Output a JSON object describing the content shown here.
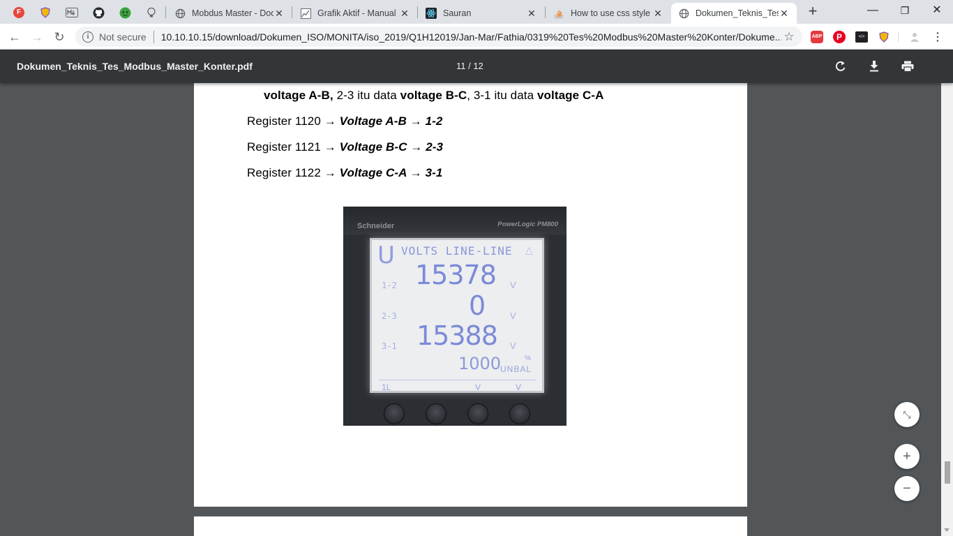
{
  "browser": {
    "pinned_tabs": [
      {
        "icon": "f-letter-icon",
        "color": "#e8453c"
      },
      {
        "icon": "shield-extension-icon",
        "color": "#f2b705"
      },
      {
        "icon": "markdown-icon",
        "color": "#5f6368"
      },
      {
        "icon": "github-icon",
        "color": "#24292e"
      },
      {
        "icon": "green-face-icon",
        "color": "#3ba13d"
      },
      {
        "icon": "bulb-icon",
        "color": "#5f6368"
      }
    ],
    "tabs": [
      {
        "title": "Mobdus Master - Doc",
        "icon": "globe-icon",
        "active": false
      },
      {
        "title": "Grafik Aktif - Manual",
        "icon": "chart-icon",
        "active": false
      },
      {
        "title": "Sauran",
        "icon": "react-icon",
        "active": false
      },
      {
        "title": "How to use css style in",
        "icon": "stackoverflow-icon",
        "active": false
      },
      {
        "title": "Dokumen_Teknis_Tes_",
        "icon": "globe-icon",
        "active": true
      }
    ],
    "new_tab_label": "+",
    "window_controls": {
      "minimize": "—",
      "restore": "❐",
      "close": "✕"
    },
    "omnibox": {
      "security_label": "Not secure",
      "url": "10.10.10.15/download/Dokumen_ISO/MONITA/iso_2019/Q1H12019/Jan-Mar/Fathia/0319%20Tes%20Modbus%20Master%20Konter/Dokume..."
    },
    "extensions": [
      {
        "name": "abp-icon",
        "text": "ABP",
        "color": "#e6393e"
      },
      {
        "name": "pinterest-icon",
        "text": "P",
        "color": "#e60023"
      },
      {
        "name": "code-extension-icon",
        "text": "</>",
        "color": "#202124"
      },
      {
        "name": "shield-extension-icon",
        "text": "",
        "color": "#f2b705"
      },
      {
        "name": "profile-icon",
        "text": "",
        "color": "#9aa0a6"
      }
    ]
  },
  "pdf": {
    "filename": "Dokumen_Teknis_Tes_Modbus_Master_Konter.pdf",
    "page_indicator": "11 / 12"
  },
  "content": {
    "intro": {
      "p1": "voltage A-B,",
      "p2": " 2-3 itu data ",
      "p3": "voltage B-C",
      "p4": ", 3-1 itu data ",
      "p5": "voltage C-A"
    },
    "registers": [
      {
        "register": "Register 1120",
        "arrow": "→",
        "label": "Voltage A-B → 1-2"
      },
      {
        "register": "Register 1121",
        "arrow": "→",
        "label": "Voltage B-C → 2-3"
      },
      {
        "register": "Register 1122",
        "arrow": "→",
        "label": "Voltage C-A → 3-1"
      }
    ],
    "meter_photo": {
      "brand": "Schneider",
      "model": "PowerLogic PM800",
      "header": "VOLTS LINE-LINE",
      "mode_letter": "U",
      "rows": [
        {
          "label": "1-2",
          "value": "15378",
          "unit": "V"
        },
        {
          "label": "2-3",
          "value": "0",
          "unit": "V"
        },
        {
          "label": "3-1",
          "value": "15388",
          "unit": "V"
        }
      ],
      "unbal_value": "1000",
      "unbal_label": "UNBAL",
      "unbal_pct": "%",
      "footer": [
        "1L",
        "V",
        "V"
      ]
    }
  },
  "zoom_controls": {
    "fit": "⤡",
    "zoom_in": "+",
    "zoom_out": "−"
  }
}
